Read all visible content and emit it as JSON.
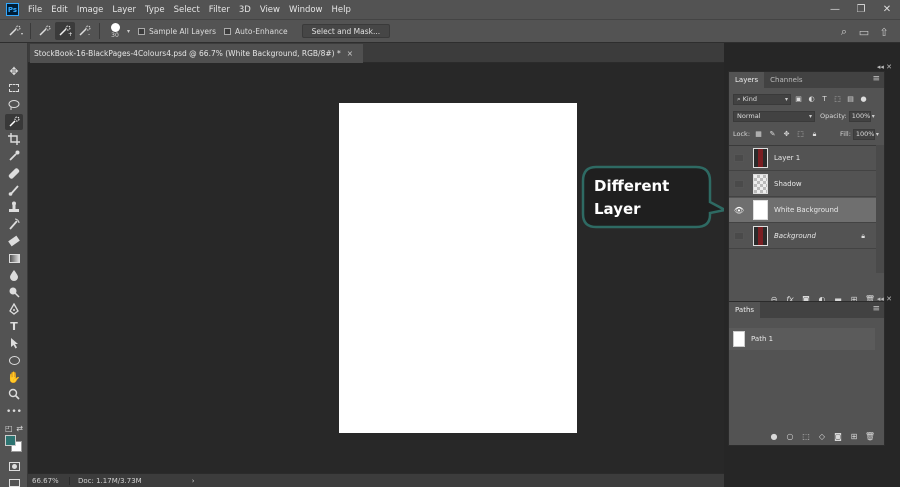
{
  "menu": {
    "logo": "Ps",
    "items": [
      "File",
      "Edit",
      "Image",
      "Layer",
      "Type",
      "Select",
      "Filter",
      "3D",
      "View",
      "Window",
      "Help"
    ],
    "window_controls": [
      "—",
      "❐",
      "✕"
    ]
  },
  "options": {
    "brush_size": "30",
    "sample_all_layers": "Sample All Layers",
    "auto_enhance": "Auto-Enhance",
    "select_and_mask": "Select and Mask..."
  },
  "document": {
    "tab_title": "StockBook-16-BlackPages-4Colours4.psd @ 66.7% (White Background, RGB/8#) *",
    "close": "×"
  },
  "status": {
    "zoom": "66.67%",
    "doc_size": "Doc: 1.17M/3.73M",
    "arrow": "›"
  },
  "callout": {
    "line1": "Different",
    "line2": "Layer",
    "border_color": "#2e6a63",
    "fill_color": "#1f1f1f"
  },
  "layers_panel": {
    "tabs": [
      "Layers",
      "Channels"
    ],
    "filter": "Kind",
    "blend_mode": "Normal",
    "opacity_label": "Opacity:",
    "opacity_value": "100%",
    "lock_label": "Lock:",
    "fill_label": "Fill:",
    "fill_value": "100%",
    "layers": [
      {
        "name": "Layer 1",
        "visible": false,
        "selected": false,
        "thumb": "red",
        "italic": false,
        "locked": false
      },
      {
        "name": "Shadow",
        "visible": false,
        "selected": false,
        "thumb": "checker",
        "italic": false,
        "locked": false
      },
      {
        "name": "White Background",
        "visible": true,
        "selected": true,
        "thumb": "white",
        "italic": false,
        "locked": false
      },
      {
        "name": "Background",
        "visible": false,
        "selected": false,
        "thumb": "red",
        "italic": true,
        "locked": true
      }
    ]
  },
  "paths_panel": {
    "tab": "Paths",
    "paths": [
      "Path 1"
    ]
  }
}
